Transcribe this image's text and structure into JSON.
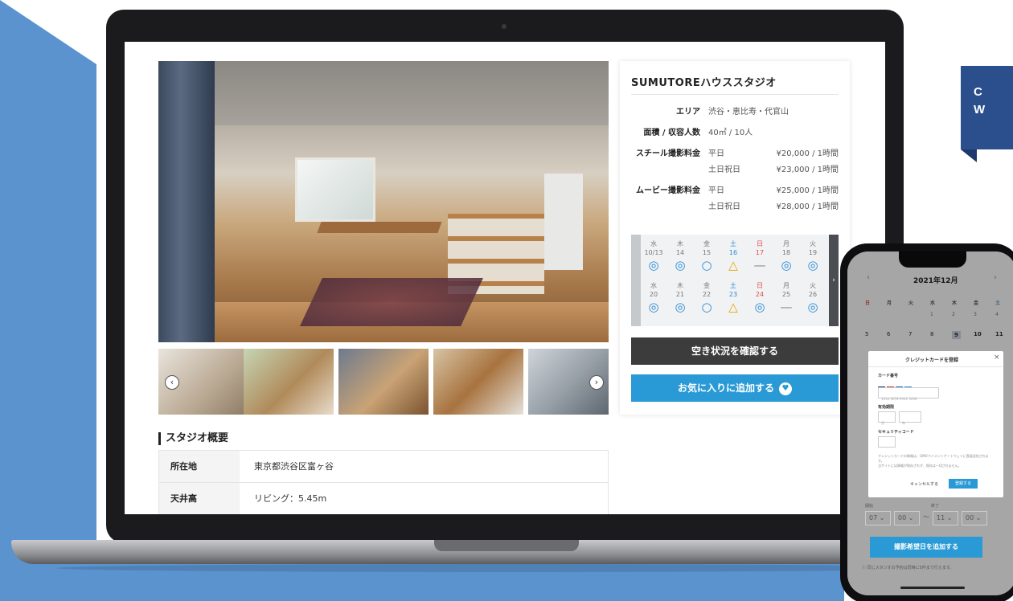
{
  "badge": {
    "line1": "C",
    "line2": "W"
  },
  "studio": {
    "title": "SUMUTOREハウススタジオ",
    "area_label": "エリア",
    "area_value": "渋谷・恵比寿・代官山",
    "size_label": "面積 / 収容人数",
    "size_value": "40㎡ / 10人",
    "still_label": "スチール撮影料金",
    "movie_label": "ムービー撮影料金",
    "weekday": "平日",
    "holiday": "土日祝日",
    "still_weekday_price": "¥20,000 / 1時間",
    "still_holiday_price": "¥23,000 / 1時間",
    "movie_weekday_price": "¥25,000 / 1時間",
    "movie_holiday_price": "¥28,000 / 1時間"
  },
  "calendar": {
    "weekdays": [
      "水",
      "木",
      "金",
      "土",
      "日",
      "月",
      "火"
    ],
    "week1_dates": [
      "10/13",
      "14",
      "15",
      "16",
      "17",
      "18",
      "19"
    ],
    "week1_marks": [
      "◎",
      "◎",
      "○",
      "△",
      "—",
      "◎",
      "◎"
    ],
    "week2_dates": [
      "20",
      "21",
      "22",
      "23",
      "24",
      "25",
      "26"
    ],
    "week2_marks": [
      "◎",
      "◎",
      "○",
      "△",
      "◎",
      "—",
      "◎"
    ],
    "next_arrow": "›"
  },
  "buttons": {
    "check_availability": "空き状況を確認する",
    "add_favorite": "お気に入りに追加する"
  },
  "overview": {
    "heading": "スタジオ概要",
    "rows": [
      {
        "key": "所在地",
        "value": "東京都渋谷区富ヶ谷"
      },
      {
        "key": "天井高",
        "value": "リビング：5.45m"
      }
    ]
  },
  "phone": {
    "month": "2021年12月",
    "prev": "‹",
    "next": "›",
    "weekdays": [
      "日",
      "月",
      "火",
      "水",
      "木",
      "金",
      "土"
    ],
    "dates_row1": [
      "1",
      "2",
      "3",
      "4"
    ],
    "dates_row2": [
      "5",
      "6",
      "7",
      "8",
      "9",
      "10",
      "11"
    ],
    "modal_title": "クレジットカードを登録",
    "modal_close": "×",
    "card_number_label": "カード番号",
    "card_number_placeholder": "1234 5678 9012 3456",
    "expiry_label": "有効期限",
    "expiry_month": "月",
    "expiry_year": "年",
    "security_label": "セキュリティコード",
    "note1": "クレジットカードの情報は、GMOペイメントゲートウェイに直接送信されます。",
    "note2": "当サイトには情報が保存されず、保存は一切されません。",
    "cancel": "キャンセルする",
    "register": "登録する",
    "start_label": "開始",
    "end_label": "終了",
    "start_hour": "07",
    "start_min": "00",
    "end_hour": "11",
    "end_min": "00",
    "tilde": "〜",
    "add_date_button": "撮影希望日を追加する",
    "footer_note": "ⓘ 同じスタジオの予約は同時に5件まで行えます。"
  }
}
